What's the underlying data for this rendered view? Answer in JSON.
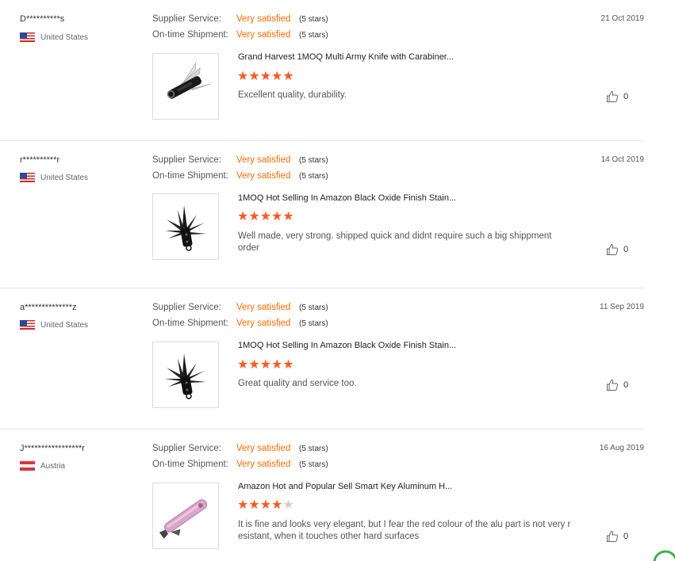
{
  "labels": {
    "supplier_service": "Supplier Service:",
    "ontime_shipment": "On-time Shipment:"
  },
  "reviews": [
    {
      "buyer": "D**********s",
      "country": "United States",
      "flag": "us",
      "supplier_rating": "Very satisfied",
      "supplier_stars": "(5 stars)",
      "shipment_rating": "Very satisfied",
      "shipment_stars": "(5 stars)",
      "date": "21 Oct 2019",
      "product_title": "Grand Harvest 1MOQ Multi Army Knife with Carabiner...",
      "rating": 5,
      "comment": "Excellent quality,  durability.",
      "likes": "0"
    },
    {
      "buyer": "r**********r",
      "country": "United States",
      "flag": "us",
      "supplier_rating": "Very satisfied",
      "supplier_stars": "(5 stars)",
      "shipment_rating": "Very satisfied",
      "shipment_stars": "(5 stars)",
      "date": "14 Oct 2019",
      "product_title": "1MOQ Hot Selling In Amazon Black Oxide Finish Stain...",
      "rating": 5,
      "comment": "Well made, very strong. shipped quick and didnt require such a big shippment order",
      "likes": "0"
    },
    {
      "buyer": "a**************z",
      "country": "United States",
      "flag": "us",
      "supplier_rating": "Very satisfied",
      "supplier_stars": "(5 stars)",
      "shipment_rating": "Very satisfied",
      "shipment_stars": "(5 stars)",
      "date": "11 Sep 2019",
      "product_title": "1MOQ Hot Selling In Amazon Black Oxide Finish Stain...",
      "rating": 5,
      "comment": "Great quality and service too.",
      "likes": "0"
    },
    {
      "buyer": "J*****************r",
      "country": "Austria",
      "flag": "at",
      "supplier_rating": "Very satisfied",
      "supplier_stars": "(5 stars)",
      "shipment_rating": "Very satisfied",
      "shipment_stars": "(5 stars)",
      "date": "16 Aug 2019",
      "product_title": "Amazon Hot and Popular Sell Smart Key Aluminum H...",
      "rating": 4,
      "comment": "It is fine and looks very elegant, but I fear the red colour of the alu part is not very resistant, when it touches other hard surfaces",
      "likes": "0"
    }
  ],
  "colors": {
    "accent": "#ff6a00",
    "star": "#ff5a1f"
  }
}
